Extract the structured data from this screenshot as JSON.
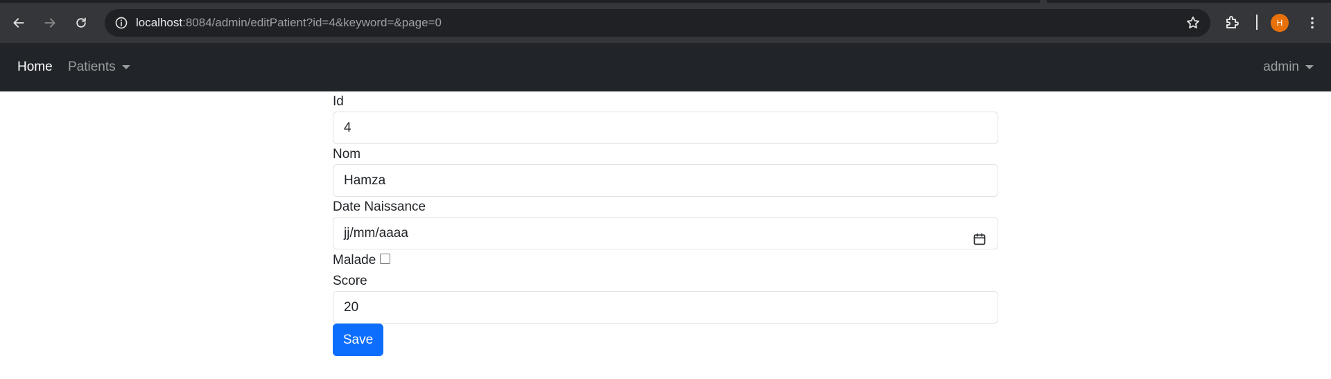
{
  "browser": {
    "url_host": "localhost",
    "url_path": ":8084/admin/editPatient?id=4&keyword=&page=0",
    "profile_initial": "H",
    "profile_color": "#e8710a"
  },
  "navbar": {
    "home": "Home",
    "patients": "Patients",
    "user": "admin"
  },
  "form": {
    "id_label": "Id",
    "id_value": "4",
    "nom_label": "Nom",
    "nom_value": "Hamza",
    "date_label": "Date Naissance",
    "date_placeholder": "jj/mm/aaaa",
    "malade_label": "Malade",
    "malade_checked": false,
    "score_label": "Score",
    "score_value": "20",
    "save_label": "Save"
  },
  "colors": {
    "navbar_bg": "#212529",
    "primary_button": "#0d6efd"
  }
}
